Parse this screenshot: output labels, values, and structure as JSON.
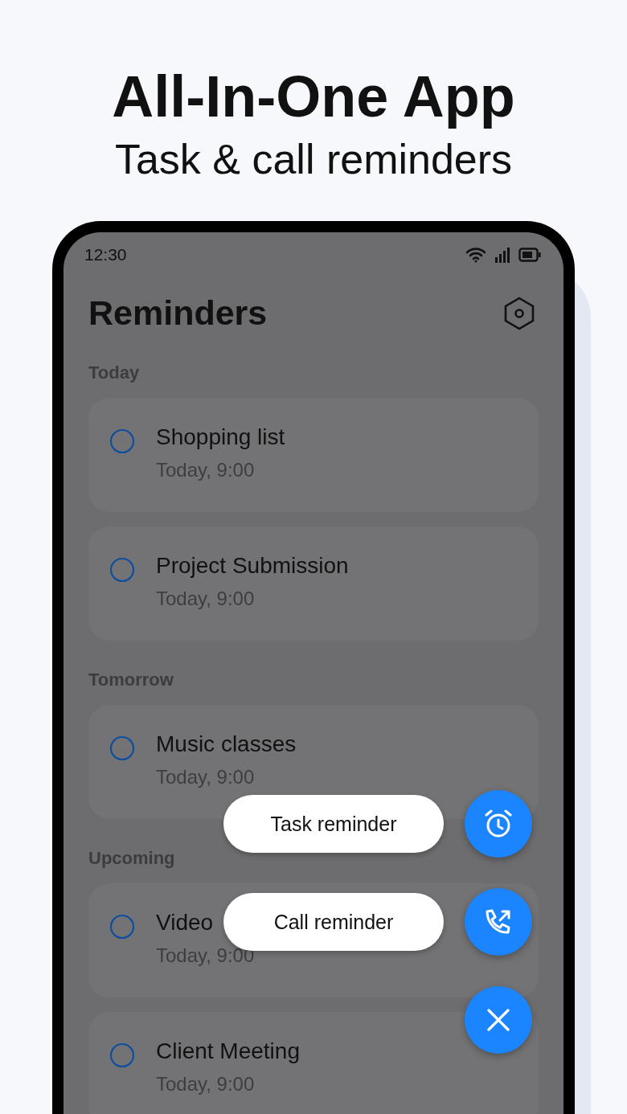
{
  "headline": "All-In-One App",
  "subheadline": "Task & call reminders",
  "status_bar": {
    "time": "12:30"
  },
  "app_bar": {
    "title": "Reminders"
  },
  "sections": [
    {
      "label": "Today",
      "items": [
        {
          "title": "Shopping list",
          "time": "Today, 9:00",
          "checked": false
        },
        {
          "title": "Project Submission",
          "time": "Today, 9:00",
          "checked": false
        }
      ]
    },
    {
      "label": "Tomorrow",
      "items": [
        {
          "title": "Music classes",
          "time": "Today, 9:00",
          "checked": false
        }
      ]
    },
    {
      "label": "Upcoming",
      "items": [
        {
          "title": "Video",
          "time": "Today, 9:00",
          "checked": false
        },
        {
          "title": "Client Meeting",
          "time": "Today, 9:00",
          "checked": false
        }
      ]
    }
  ],
  "fab_menu": [
    {
      "label": "Task reminder",
      "kind": "alarm"
    },
    {
      "label": "Call reminder",
      "kind": "call"
    },
    {
      "kind": "close"
    }
  ]
}
